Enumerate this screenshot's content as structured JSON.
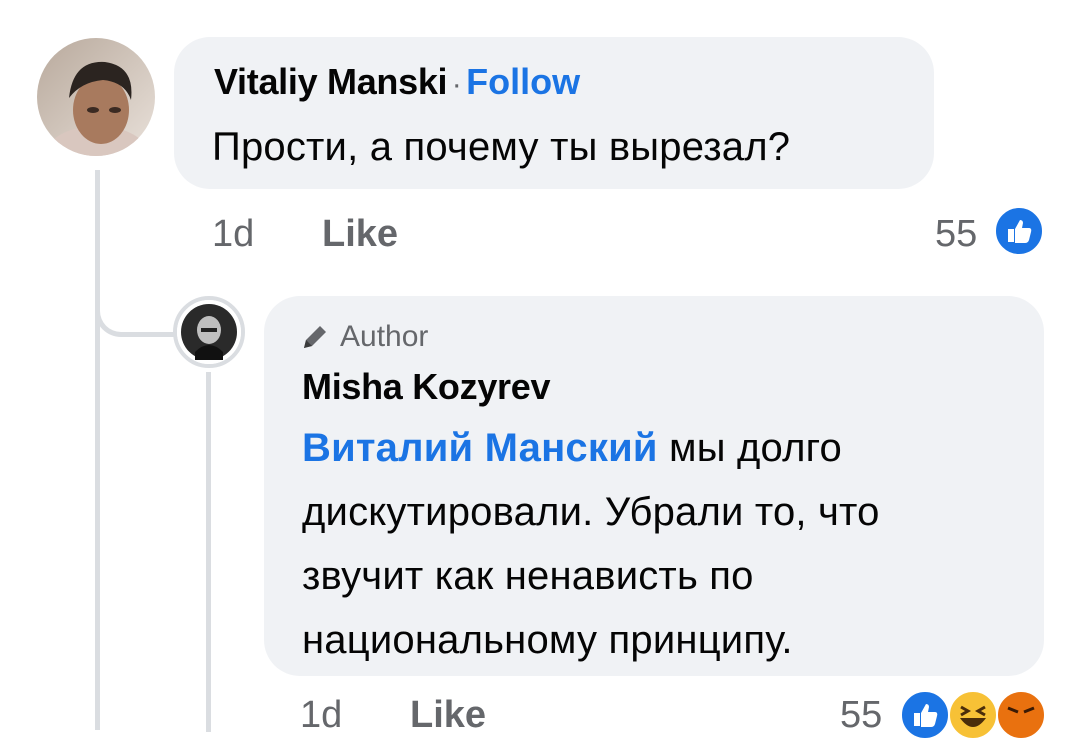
{
  "comment": {
    "author": "Vitaliy Manski",
    "separator": "·",
    "follow_label": "Follow",
    "text": "Прости, а почему ты вырезал?",
    "time": "1d",
    "like_label": "Like",
    "reaction_count": "55",
    "reactions": [
      "like-icon"
    ]
  },
  "reply": {
    "badge_label": "Author",
    "author": "Misha Kozyrev",
    "mention": "Виталий Манский",
    "text_lines": [
      " мы долго",
      "дискутировали. Убрали то, что",
      "звучит как ненависть по",
      "национальному принципу."
    ],
    "time": "1d",
    "like_label": "Like",
    "reaction_count": "55",
    "reactions": [
      "like-icon",
      "haha-icon",
      "angry-icon"
    ]
  },
  "colors": {
    "bubble": "#f0f2f5",
    "link": "#1b74e4",
    "meta": "#65676b",
    "thread_line": "#dadde1"
  }
}
